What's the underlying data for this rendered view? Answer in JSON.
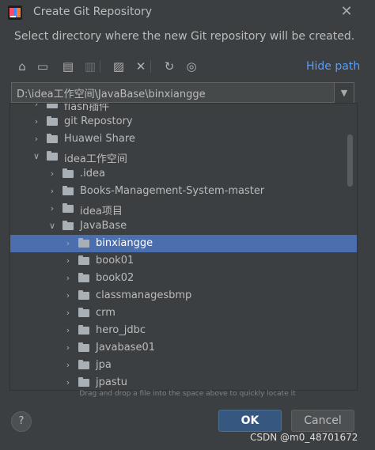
{
  "window": {
    "title": "Create Git Repository"
  },
  "description": "Select directory where the new Git repository will be created.",
  "toolbar": {
    "buttons": [
      {
        "icon": "home-icon",
        "glyph": "⌂",
        "enabled": true
      },
      {
        "icon": "desktop-icon",
        "glyph": "▭",
        "enabled": true
      },
      {
        "icon": "project-folder-icon",
        "glyph": "▤",
        "enabled": true
      },
      {
        "icon": "module-folder-icon",
        "glyph": "▥",
        "enabled": false
      },
      {
        "icon": "new-folder-icon",
        "glyph": "▨",
        "enabled": true
      },
      {
        "icon": "delete-icon",
        "glyph": "✕",
        "enabled": true
      },
      {
        "icon": "refresh-icon",
        "glyph": "↻",
        "enabled": true
      },
      {
        "icon": "show-hidden-icon",
        "glyph": "◎",
        "enabled": true
      }
    ],
    "hide_path_label": "Hide path"
  },
  "path": {
    "value": "D:\\idea工作空间\\JavaBase\\binxiangge"
  },
  "tree": {
    "items": [
      {
        "label": "flash插件",
        "expanded": false,
        "selected": false
      },
      {
        "label": "git Repostory",
        "expanded": false,
        "selected": false
      },
      {
        "label": "Huawei Share",
        "expanded": false,
        "selected": false
      },
      {
        "label": "idea工作空间",
        "expanded": true,
        "selected": false
      },
      {
        "label": ".idea",
        "expanded": false,
        "selected": false
      },
      {
        "label": "Books-Management-System-master",
        "expanded": false,
        "selected": false
      },
      {
        "label": "idea项目",
        "expanded": false,
        "selected": false
      },
      {
        "label": "JavaBase",
        "expanded": true,
        "selected": false
      },
      {
        "label": "binxiangge",
        "expanded": false,
        "selected": true
      },
      {
        "label": "book01",
        "expanded": false,
        "selected": false
      },
      {
        "label": "book02",
        "expanded": false,
        "selected": false
      },
      {
        "label": "classmanagesbmp",
        "expanded": false,
        "selected": false
      },
      {
        "label": "crm",
        "expanded": false,
        "selected": false
      },
      {
        "label": "hero_jdbc",
        "expanded": false,
        "selected": false
      },
      {
        "label": "Javabase01",
        "expanded": false,
        "selected": false
      },
      {
        "label": "jpa",
        "expanded": false,
        "selected": false
      },
      {
        "label": "jpastu",
        "expanded": false,
        "selected": false
      }
    ]
  },
  "hint": "Drag and drop a file into the space above to quickly locate it",
  "buttons": {
    "help": "?",
    "ok": "OK",
    "cancel": "Cancel"
  },
  "watermark": "CSDN @m0_48701672",
  "colors": {
    "background": "#3c3f41",
    "selection": "#4b6eaf",
    "link": "#589df6",
    "ok_button": "#365880"
  }
}
